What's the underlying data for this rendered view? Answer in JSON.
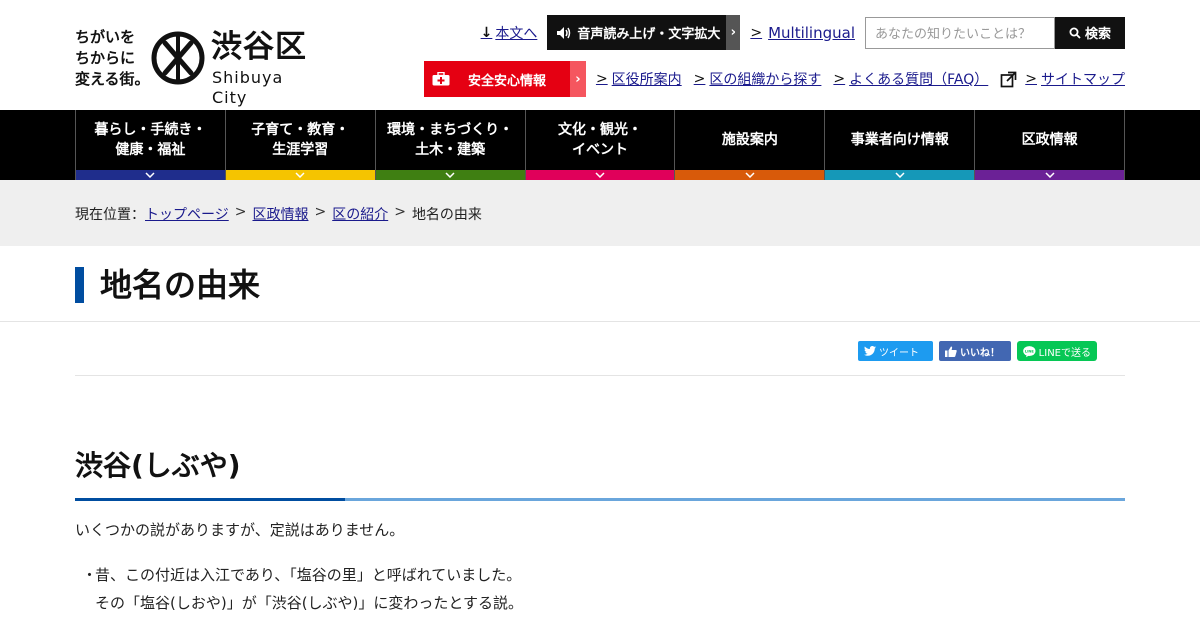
{
  "logo": {
    "tagline": [
      "ちがいを",
      "ちからに",
      "変える街。"
    ],
    "kanji": "渋谷区",
    "roman": "Shibuya City"
  },
  "utility": {
    "skip_link": "本文へ",
    "voice_button": "音声読み上げ・文字拡大",
    "multilingual": "Multilingual",
    "search_placeholder": "あなたの知りたいことは？",
    "search_button": "検索",
    "safety_button": "安全安心情報",
    "links": [
      "区役所案内",
      "区の組織から探す",
      "よくある質問（FAQ）",
      "サイトマップ"
    ]
  },
  "gnav": [
    {
      "line1": "暮らし・手続き・",
      "line2": "健康・福祉",
      "color": "#1f2d8c"
    },
    {
      "line1": "子育て・教育・",
      "line2": "生涯学習",
      "color": "#f5c400"
    },
    {
      "line1": "環境・まちづくり・",
      "line2": "土木・建築",
      "color": "#3f7f12"
    },
    {
      "line1": "文化・観光・",
      "line2": "イベント",
      "color": "#e0005a"
    },
    {
      "line1": "施設案内",
      "line2": "",
      "color": "#d85a0a"
    },
    {
      "line1": "事業者向け情報",
      "line2": "",
      "color": "#1598b8"
    },
    {
      "line1": "区政情報",
      "line2": "",
      "color": "#6b2196"
    }
  ],
  "breadcrumb": {
    "label": "現在位置：",
    "items": [
      "トップページ",
      "区政情報",
      "区の紹介"
    ],
    "current": "地名の由来"
  },
  "page_title": "地名の由来",
  "share": {
    "tweet": "ツイート",
    "like": "いいね！",
    "line": "LINEで送る"
  },
  "content": {
    "heading": "渋谷(しぶや)",
    "lead": "いくつかの説がありますが、定説はありません。",
    "bullet_mark": "・",
    "bullet_line1": "昔、この付近は入江であり、「塩谷の里」と呼ばれていました。",
    "bullet_line2": "その「塩谷(しおや)」が「渋谷(しぶや)」に変わったとする説。"
  }
}
